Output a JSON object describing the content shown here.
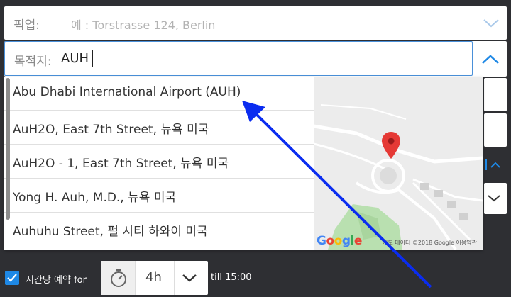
{
  "pickup": {
    "label": "픽업:",
    "placeholder": "예 : Torstrasse 124, Berlin"
  },
  "destination": {
    "label": "목적지:",
    "value": "AUH"
  },
  "suggestions": [
    "Abu Dhabi International Airport (AUH)",
    "AuH2O, East 7th Street, 뉴욕 미국",
    "AuH2O - 1, East 7th Street, 뉴욕 미국",
    "Yong H. Auh, M.D., 뉴욕 미국",
    "Auhuhu Street, 펄 시티 하와이 미국"
  ],
  "map": {
    "logo": "Google",
    "attribution": "지도 데이터 ©2018 Google   이용약관"
  },
  "hourly": {
    "label": "시간당 예약 for",
    "checked": true,
    "duration": "4h",
    "till": "till 15:00"
  },
  "colors": {
    "accent": "#1e88e5",
    "arrow": "#0a2cf0",
    "pin": "#e53935"
  }
}
